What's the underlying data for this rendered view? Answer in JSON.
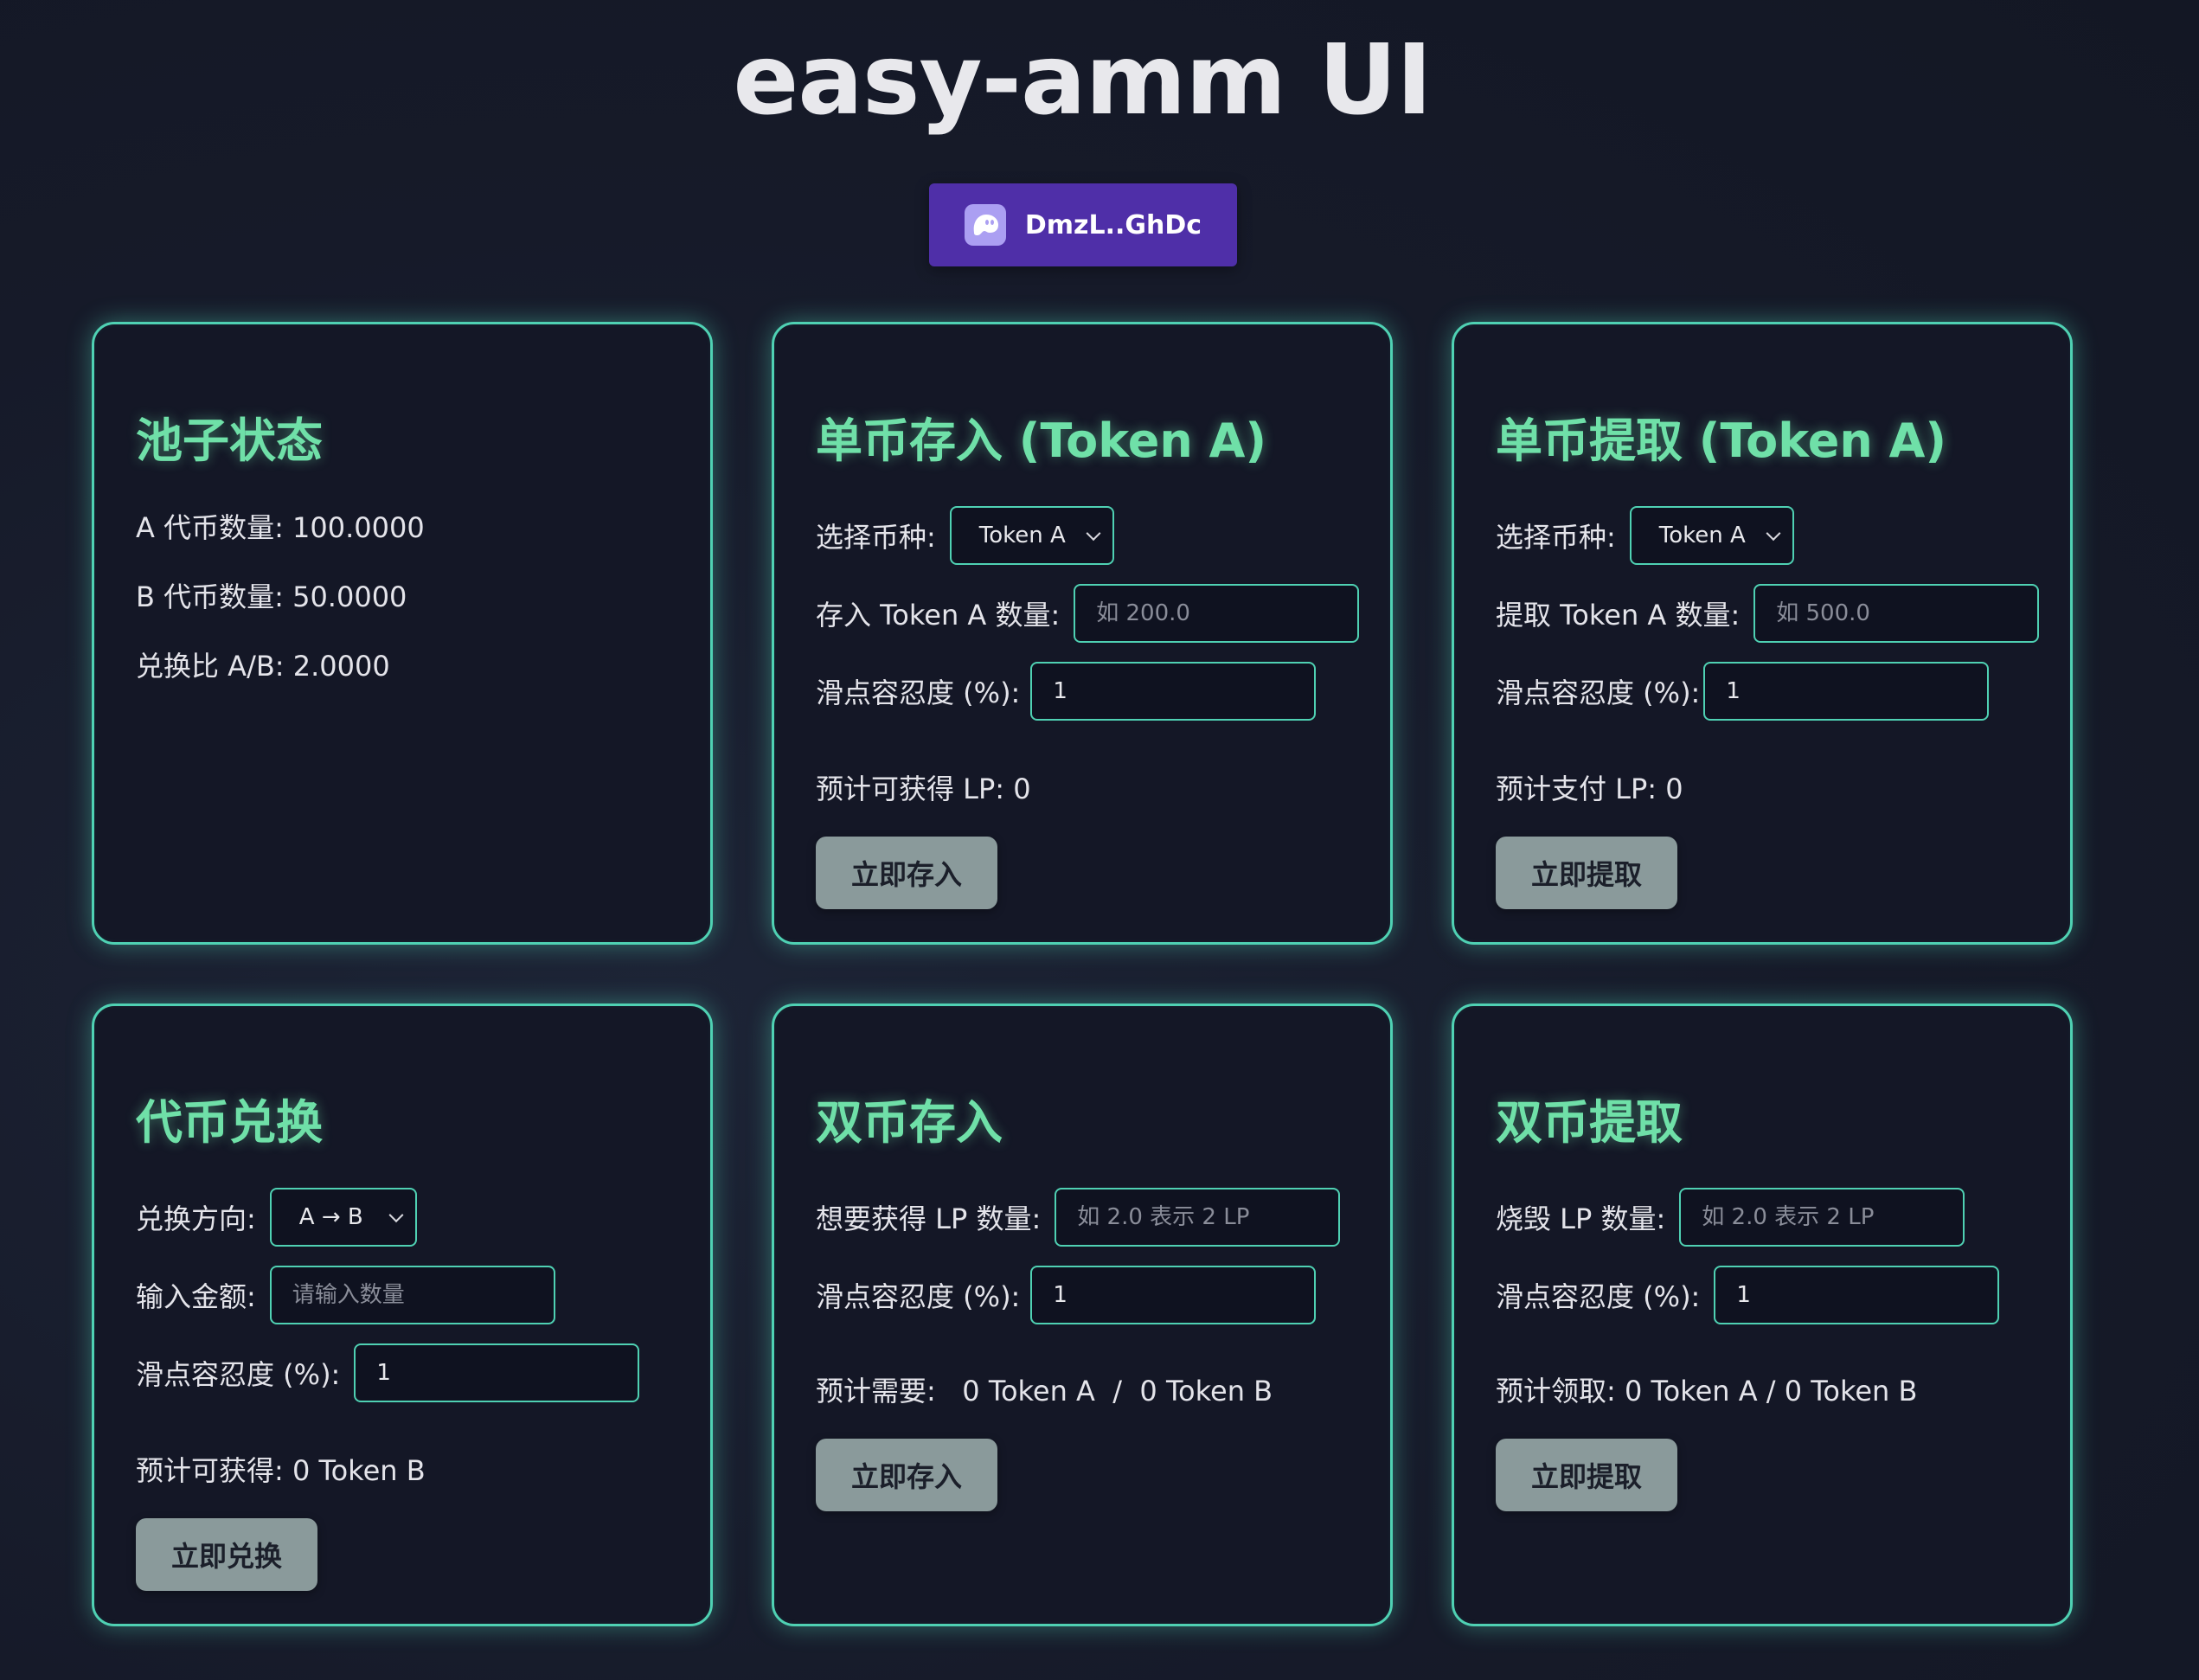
{
  "app": {
    "title": "easy-amm UI"
  },
  "wallet": {
    "address": "DmzL..GhDc",
    "icon": "ghost-icon",
    "color": "#4f2fa8"
  },
  "pool_status": {
    "title": "池子状态",
    "token_a": "A 代币数量: 100.0000",
    "token_b": "B 代币数量: 50.0000",
    "ratio": "兑换比 A/B: 2.0000"
  },
  "single_deposit": {
    "title": "单币存入 (Token A)",
    "select_label": "选择币种:",
    "select_value": "Token A",
    "amount_label": "存入 Token A 数量:",
    "amount_placeholder": "如 200.0",
    "slippage_label": "滑点容忍度 (%):",
    "slippage_value": "1",
    "estimate": "预计可获得 LP: 0",
    "button": "立即存入"
  },
  "single_withdraw": {
    "title": "单币提取 (Token A)",
    "select_label": "选择币种:",
    "select_value": "Token A",
    "amount_label": "提取 Token A 数量:",
    "amount_placeholder": "如 500.0",
    "slippage_label": "滑点容忍度 (%):",
    "slippage_value": "1",
    "estimate": "预计支付 LP: 0",
    "button": "立即提取"
  },
  "swap": {
    "title": "代币兑换",
    "direction_label": "兑换方向:",
    "direction_value": "A → B",
    "amount_label": "输入金额:",
    "amount_placeholder": "请输入数量",
    "slippage_label": "滑点容忍度 (%):",
    "slippage_value": "1",
    "estimate": "预计可获得: 0 Token B",
    "button": "立即兑换"
  },
  "dual_deposit": {
    "title": "双币存入",
    "lp_label": "想要获得 LP 数量:",
    "lp_placeholder": "如 2.0 表示 2 LP",
    "slippage_label": "滑点容忍度 (%):",
    "slippage_value": "1",
    "estimate": "预计需要:   0 Token A  /  0 Token B",
    "button": "立即存入"
  },
  "dual_withdraw": {
    "title": "双币提取",
    "lp_label": "烧毁 LP 数量:",
    "lp_placeholder": "如 2.0 表示 2 LP",
    "slippage_label": "滑点容忍度 (%):",
    "slippage_value": "1",
    "estimate": "预计领取: 0 Token A / 0 Token B",
    "button": "立即提取"
  },
  "theme": {
    "accent": "#4fd1b3",
    "heading": "#6fe0a8",
    "button_bg": "#8a9a9b"
  }
}
